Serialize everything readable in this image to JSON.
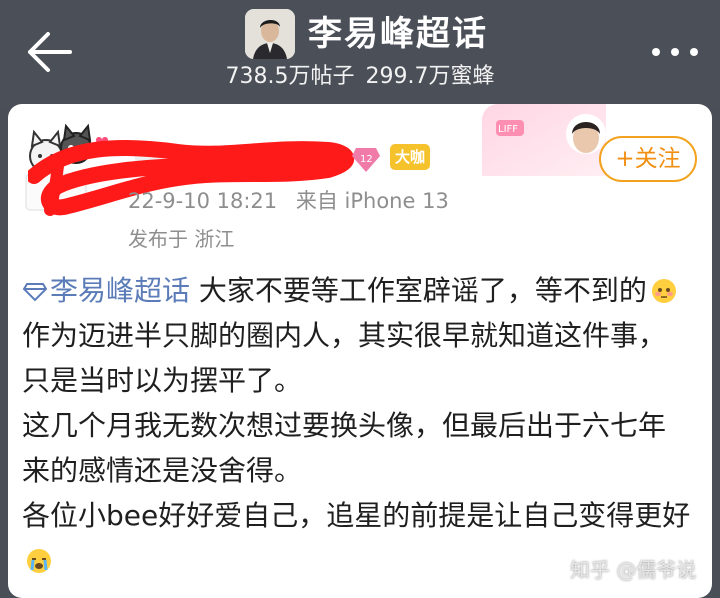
{
  "header": {
    "title": "李易峰超话",
    "posts_count": "738.5万帖子",
    "fans_count": "299.7万蜜蜂"
  },
  "post": {
    "badge_vip": "大咖",
    "timestamp": "22-9-10 18:21",
    "source": "来自 iPhone 13",
    "location": "发布于 浙江",
    "follow_label": "+关注",
    "topic_link": "李易峰超话",
    "text_1": "大家不要等工作室辟谣了，等不到的",
    "text_2": "作为迈进半只脚的圈内人，其实很早就知道这件事，只是当时以为摆平了。",
    "text_3": "这几个月我无数次想过要换头像，但最后出于六七年来的感情还是没舍得。",
    "text_4": "各位小bee好好爱自己，追星的前提是让自己变得更好"
  },
  "watermark": "知乎 @儒爷说",
  "icons": {
    "back": "back-arrow-icon",
    "more": "more-dots-icon",
    "topic": "diamond-topic-icon",
    "emoji_1": "flushed-face-emoji",
    "emoji_2": "crying-face-emoji"
  },
  "colors": {
    "header_bg": "#4b5058",
    "link": "#5b7cb8",
    "follow": "#f08f12",
    "scribble": "#ff1a1a",
    "vip_badge": "#f6c22c"
  }
}
